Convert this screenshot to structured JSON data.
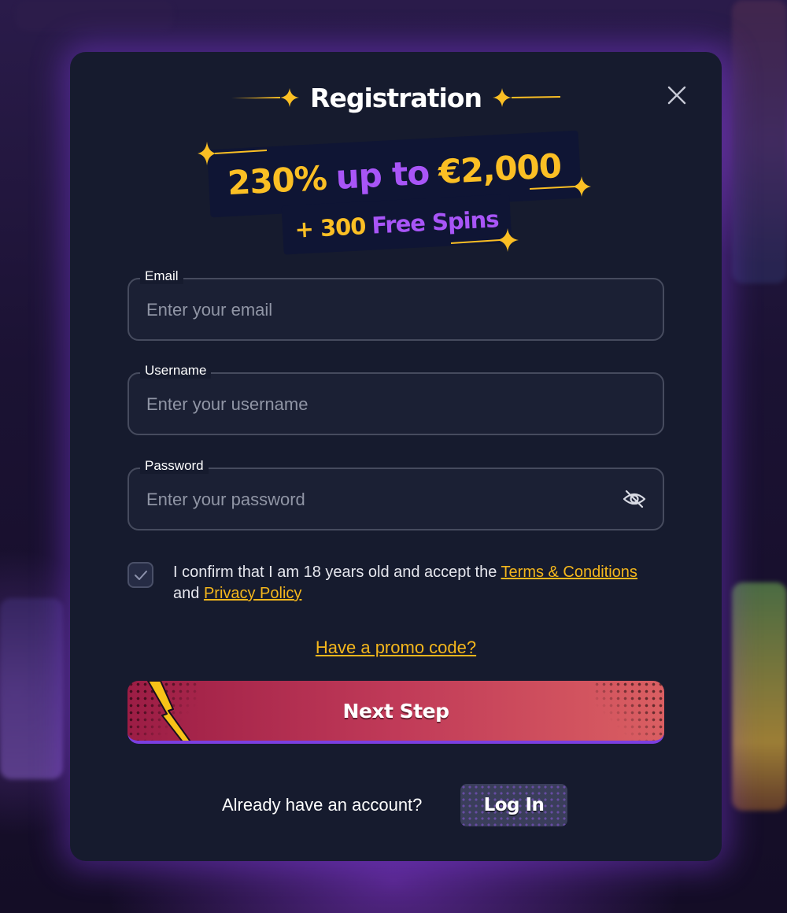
{
  "modal": {
    "title": "Registration"
  },
  "promo": {
    "percent": "230%",
    "up_to": "up to",
    "amount": "€2,000",
    "plus_amount": "+ 300",
    "free_spins": "Free Spins"
  },
  "form": {
    "email": {
      "label": "Email",
      "placeholder": "Enter your email"
    },
    "username": {
      "label": "Username",
      "placeholder": "Enter your username"
    },
    "password": {
      "label": "Password",
      "placeholder": "Enter your password"
    }
  },
  "terms": {
    "text_before": "I confirm that I am 18 years old and accept the",
    "terms_link": "Terms & Conditions",
    "and": "and",
    "privacy_link": "Privacy Policy",
    "checked": true
  },
  "promo_code_link": "Have a promo code?",
  "next_button": "Next Step",
  "login": {
    "prompt": "Already have an account?",
    "button": "Log In"
  },
  "colors": {
    "accent_gold": "#fbbf24",
    "accent_purple": "#a855f7",
    "modal_bg": "#161b2e",
    "link": "#f5b71c"
  },
  "icons": {
    "close": "close-icon",
    "eye": "eye-off-icon",
    "check": "check-icon",
    "sparkle": "sparkle-icon",
    "bolt": "lightning-bolt-icon"
  }
}
